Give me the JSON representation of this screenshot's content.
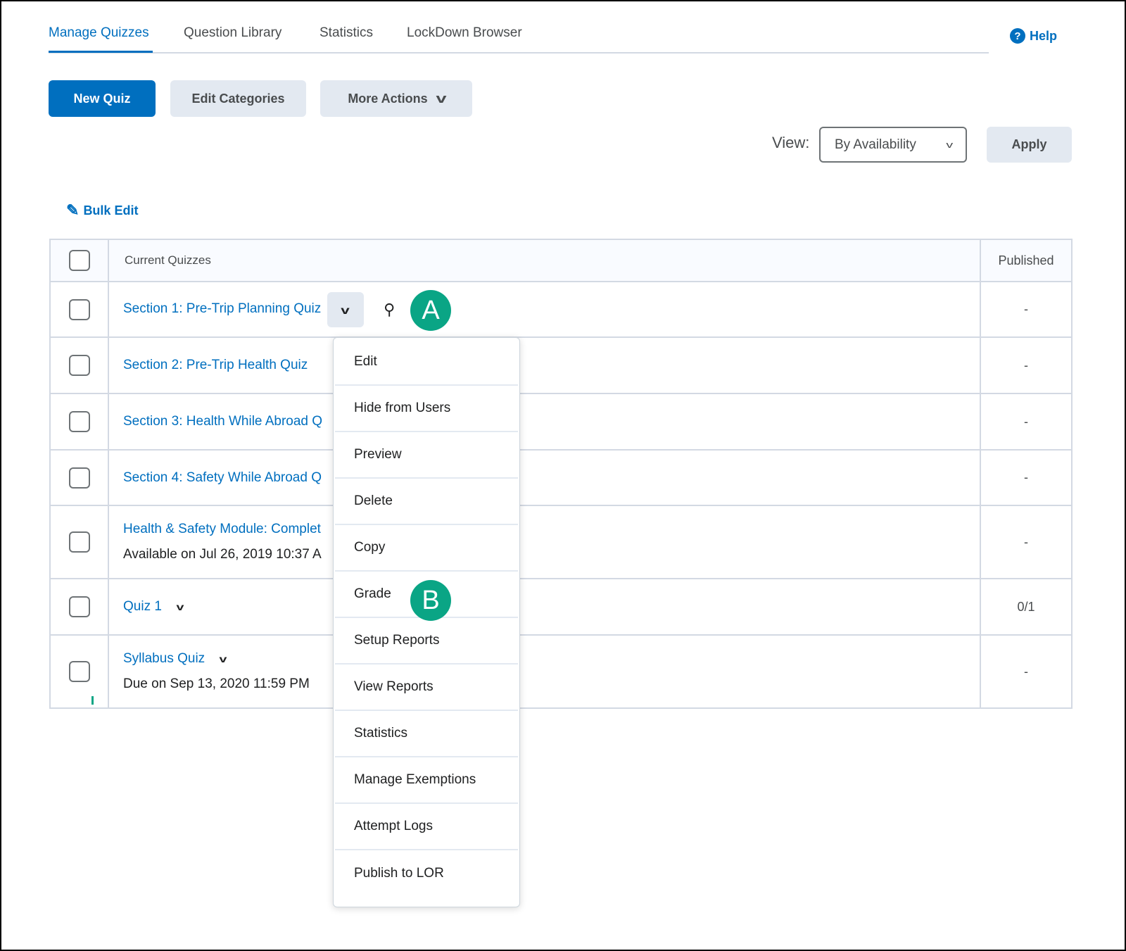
{
  "tabs": [
    {
      "label": "Manage Quizzes",
      "active": true
    },
    {
      "label": "Question Library"
    },
    {
      "label": "Statistics"
    },
    {
      "label": "LockDown Browser"
    }
  ],
  "help": {
    "label": "Help",
    "icon": "question-circle-icon"
  },
  "toolbar": {
    "new_quiz": "New Quiz",
    "edit_categories": "Edit Categories",
    "more_actions": "More Actions"
  },
  "view": {
    "label": "View:",
    "selected": "By Availability",
    "apply": "Apply"
  },
  "bulk_edit": "Bulk Edit",
  "table": {
    "headers": [
      "Current Quizzes",
      "Published"
    ],
    "rows": [
      {
        "name": "Section 1: Pre-Trip Planning Quiz",
        "published": "-"
      },
      {
        "name": "Section 2: Pre-Trip Health Quiz",
        "published": "-"
      },
      {
        "name": "Section 3: Health While Abroad Q",
        "published": "-"
      },
      {
        "name": "Section 4: Safety While Abroad Q",
        "published": "-"
      },
      {
        "name": "Health & Safety Module: Complet",
        "sub": "Available on Jul 26, 2019 10:37 A",
        "published": "-"
      },
      {
        "name": "Quiz 1",
        "published": "0/1"
      },
      {
        "name": "Syllabus Quiz",
        "sub": "Due on Sep 13, 2020 11:59 PM",
        "published": "-"
      }
    ]
  },
  "menu": [
    "Edit",
    "Hide from Users",
    "Preview",
    "Delete",
    "Copy",
    "Grade",
    "Setup Reports",
    "View Reports",
    "Statistics",
    "Manage Exemptions",
    "Attempt Logs",
    "Publish to LOR"
  ],
  "annotations": {
    "a": "A",
    "b": "B"
  },
  "colors": {
    "accent": "#006fbf",
    "badge": "#0aa585"
  }
}
